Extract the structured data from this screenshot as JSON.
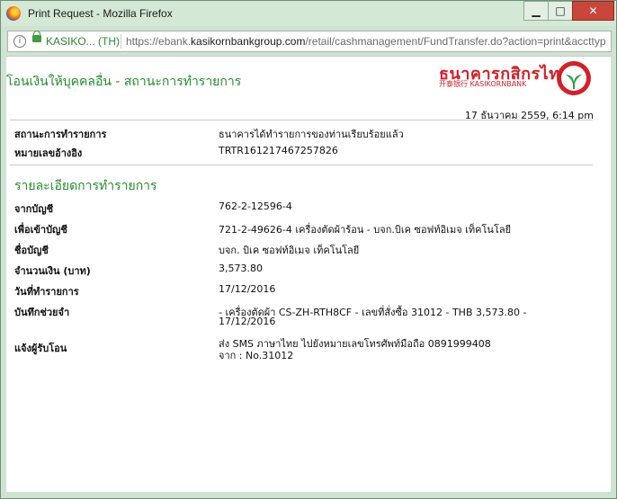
{
  "window": {
    "title": "Print Request - Mozilla Firefox",
    "minimize": "▁",
    "maximize": "□",
    "close": "✕"
  },
  "urlbar": {
    "site_identity": "KASIKO... (TH)",
    "url_prefix": "https://ebank.",
    "url_domain": "kasikornbankgroup.com",
    "url_rest": "/retail/cashmanagement/FundTransfer.do?action=print&accttyp"
  },
  "header": {
    "page_title": "โอนเงินให้บุคคลอื่น - สถานะการทำรายการ",
    "logo_thai": "ธนาคารกสิกรไทย",
    "logo_en": "开泰银行 KASIKORNBANK",
    "datetime": "17 ธันวาคม 2559, 6:14 pm"
  },
  "status": {
    "label1": "สถานะการทำรายการ",
    "value1": "ธนาคารได้ทำรายการของท่านเรียบร้อยแล้ว",
    "label2": "หมายเลขอ้างอิง",
    "value2": "TRTR161217467257826"
  },
  "details": {
    "heading": "รายละเอียดการทำรายการ",
    "from_label": "จากบัญชี",
    "from_value": "762-2-12596-4",
    "to_label": "เพื่อเข้าบัญชี",
    "to_value": "721-2-49626-4 เครื่องตัดผ้าร้อน - บจก.บิเค ซอฟท์อิเมจ เท็คโนโลยี",
    "name_label": "ชื่อบัญชี",
    "name_value": "บจก. บิเค ซอฟท์อิเมจ เท็คโนโลยี",
    "amount_label": "จำนวนเงิน (บาท)",
    "amount_value": "3,573.80",
    "date_label": "วันที่ทำรายการ",
    "date_value": "17/12/2016",
    "memo_label": "บันทึกช่วยจำ",
    "memo_line1": "- เครื่องตัดผ้า CS-ZH-RTH8CF - เลขที่สั่งซื้อ 31012 - THB 3,573.80 -",
    "memo_line2": "17/12/2016",
    "notify_label": "แจ้งผู้รับโอน",
    "notify_line1": "ส่ง SMS ภาษาไทย ไปยังหมายเลขโทรศัพท์มือถือ 0891999408",
    "notify_line2": "จาก : No.31012"
  }
}
